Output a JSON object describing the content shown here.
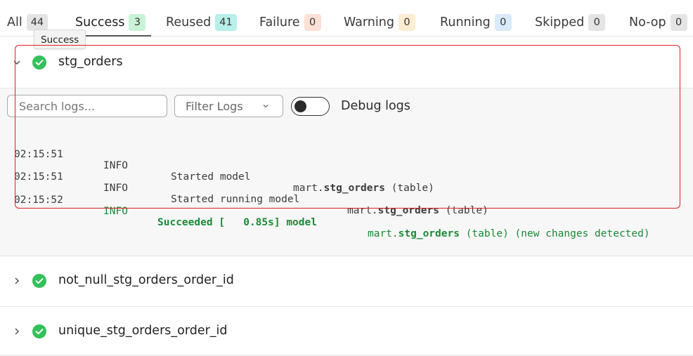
{
  "tabs": [
    {
      "label": "All",
      "count": "44",
      "badge": "gray"
    },
    {
      "label": "Success",
      "count": "3",
      "badge": "green"
    },
    {
      "label": "Reused",
      "count": "41",
      "badge": "teal"
    },
    {
      "label": "Failure",
      "count": "0",
      "badge": "salmon"
    },
    {
      "label": "Warning",
      "count": "0",
      "badge": "orange"
    },
    {
      "label": "Running",
      "count": "0",
      "badge": "blue"
    },
    {
      "label": "Skipped",
      "count": "0",
      "badge": "gray"
    },
    {
      "label": "No-op",
      "count": "0",
      "badge": "gray"
    }
  ],
  "active_tab": "Success",
  "tooltip": "Success",
  "expanded_row": {
    "title": "stg_orders",
    "status_icon": "check-circle-icon",
    "search_placeholder": "Search logs...",
    "filter_label": "Filter Logs",
    "debug_label": "Debug logs",
    "debug_enabled": false,
    "logs": [
      {
        "time": "02:15:51",
        "level": "INFO",
        "message": "Started model",
        "schema": "mart.",
        "model": "stg_orders",
        "suffix": " (table)"
      },
      {
        "time": "02:15:51",
        "level": "INFO",
        "message": "Started running model",
        "schema": "mart.",
        "model": "stg_orders",
        "suffix": " (table)"
      },
      {
        "time": "02:15:52",
        "level": "INFO",
        "message": "Succeeded [   0.85s] model",
        "schema": "mart.",
        "model": "stg_orders",
        "suffix": " (table) (new changes detected)"
      }
    ]
  },
  "rows": [
    {
      "title": "not_null_stg_orders_order_id"
    },
    {
      "title": "unique_stg_orders_order_id"
    }
  ],
  "colors": {
    "success": "#34c05a",
    "highlight": "#e02020",
    "log_success": "#1a8a36"
  }
}
